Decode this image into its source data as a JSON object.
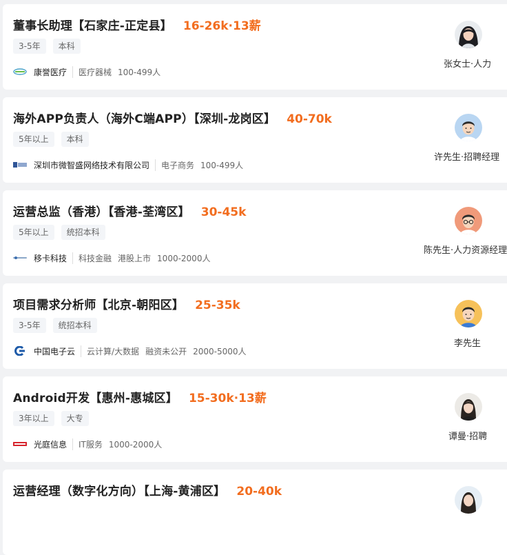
{
  "jobs": [
    {
      "title": "董事长助理【石家庄-正定县】",
      "salary": "16-26k·13薪",
      "tags": [
        "3-5年",
        "本科"
      ],
      "company": "康誉医疗",
      "meta": [
        "医疗器械",
        "100-499人"
      ],
      "recruiter": "张女士·人力",
      "logo_icon": "kangyu-logo-icon",
      "avatar_icon": "female-photo-avatar-icon"
    },
    {
      "title": "海外APP负责人（海外C端APP）【深圳-龙岗区】",
      "salary": "40-70k",
      "tags": [
        "5年以上",
        "本科"
      ],
      "company": "深圳市微智盛网络技术有限公司",
      "meta": [
        "电子商务",
        "100-499人"
      ],
      "recruiter": "许先生·招聘经理",
      "logo_icon": "weizhisheng-logo-icon",
      "avatar_icon": "cartoon-man-avatar-icon"
    },
    {
      "title": "运营总监（香港）【香港-荃湾区】",
      "salary": "30-45k",
      "tags": [
        "5年以上",
        "统招本科"
      ],
      "company": "移卡科技",
      "meta": [
        "科技金融",
        "港股上市",
        "1000-2000人"
      ],
      "recruiter": "陈先生·人力资源经理",
      "logo_icon": "yika-logo-icon",
      "avatar_icon": "cartoon-glasses-man-avatar-icon"
    },
    {
      "title": "项目需求分析师【北京-朝阳区】",
      "salary": "25-35k",
      "tags": [
        "3-5年",
        "统招本科"
      ],
      "company": "中国电子云",
      "meta": [
        "云计算/大数据",
        "融资未公开",
        "2000-5000人"
      ],
      "recruiter": "李先生",
      "logo_icon": "cec-cloud-logo-icon",
      "avatar_icon": "cartoon-man-avatar-icon"
    },
    {
      "title": "Android开发【惠州-惠城区】",
      "salary": "15-30k·13薪",
      "tags": [
        "3年以上",
        "大专"
      ],
      "company": "光庭信息",
      "meta": [
        "IT服务",
        "1000-2000人"
      ],
      "recruiter": "谭曼·招聘",
      "logo_icon": "kotei-logo-icon",
      "avatar_icon": "female-photo-avatar-icon"
    },
    {
      "title": "运营经理（数字化方向）【上海-黄浦区】",
      "salary": "20-40k",
      "tags": [],
      "company": "",
      "meta": [],
      "recruiter": "",
      "logo_icon": "",
      "avatar_icon": "female-photo-avatar-icon"
    }
  ],
  "colors": {
    "salary": "#f26d1f",
    "background": "#f1f2f4",
    "card": "#ffffff"
  }
}
